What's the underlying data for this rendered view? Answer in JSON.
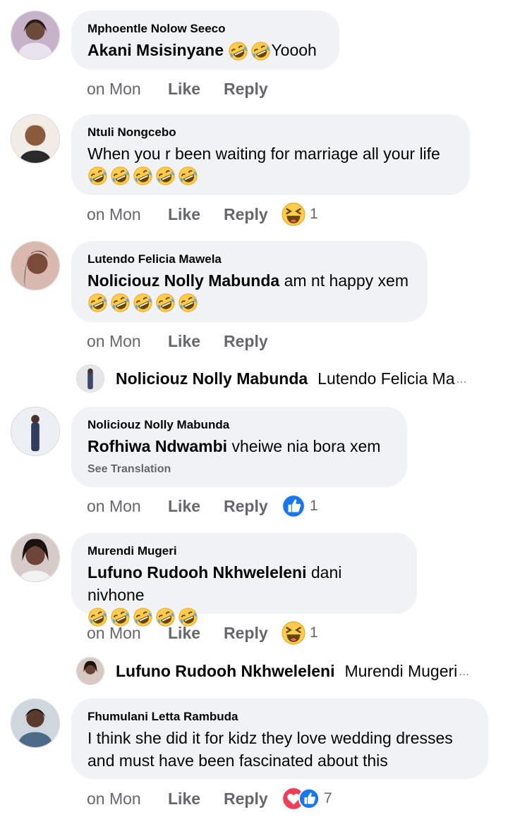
{
  "comments": [
    {
      "author": "Mphoentle Nolow Seeco",
      "mention": "Akani Msisinyane",
      "text": "Yoooh",
      "time": "on Mon",
      "like": "Like",
      "reply": "Reply"
    },
    {
      "author": "Ntuli Nongcebo",
      "text": "When you r been waiting for marriage all your life",
      "time": "on Mon",
      "like": "Like",
      "reply": "Reply",
      "reaction_count": "1"
    },
    {
      "author": "Lutendo Felicia Mawela",
      "mention": "Noliciouz Nolly Mabunda",
      "text": "am nt happy xem",
      "time": "on Mon",
      "like": "Like",
      "reply": "Reply",
      "reply_preview": {
        "name": "Noliciouz Nolly Mabunda",
        "text": "Lutendo Felicia Ma",
        "ellipsis": "..."
      }
    },
    {
      "author": "Noliciouz Nolly Mabunda",
      "mention": "Rofhiwa Ndwambi",
      "text": "vheiwe nia bora xem",
      "see_translation": "See Translation",
      "time": "on Mon",
      "like": "Like",
      "reply": "Reply",
      "reaction_count": "1"
    },
    {
      "author": "Murendi Mugeri",
      "mention": "Lufuno Rudooh Nkhweleleni",
      "text": "dani nivhone",
      "time": "on Mon",
      "like": "Like",
      "reply": "Reply",
      "reaction_count": "1",
      "reply_preview": {
        "name": "Lufuno Rudooh Nkhweleleni",
        "text": "Murendi Mugeri",
        "ellipsis": "..."
      }
    },
    {
      "author": "Fhumulani Letta Rambuda",
      "text_line1": "I think she did it for kidz they love wedding dresses",
      "text_line2": "and must have been fascinated about this",
      "time": "on Mon",
      "like": "Like",
      "reply": "Reply",
      "reaction_count": "7"
    }
  ],
  "colors": {
    "bubble": "#f0f2f5",
    "meta_text": "#65676b",
    "like_blue": "#1877f2",
    "love_red": "#f33e58",
    "emoji_yellow": "#ffcc4d"
  },
  "icons": [
    "rolling-laughing-emoji",
    "squinting-laugh-reaction",
    "like-reaction",
    "love-reaction"
  ]
}
